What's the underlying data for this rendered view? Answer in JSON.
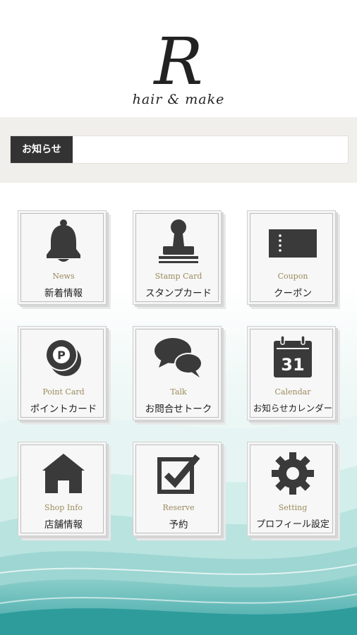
{
  "header": {
    "logo_letter": "R",
    "logo_subtitle": "hair & make"
  },
  "notice": {
    "tag_label": "お知らせ",
    "text": ""
  },
  "menu": [
    {
      "en": "News",
      "jp": "新着情報",
      "icon": "bell-icon"
    },
    {
      "en": "Stamp Card",
      "jp": "スタンプカード",
      "icon": "stamp-icon"
    },
    {
      "en": "Coupon",
      "jp": "クーポン",
      "icon": "ticket-icon"
    },
    {
      "en": "Point Card",
      "jp": "ポイントカード",
      "icon": "point-coins-icon"
    },
    {
      "en": "Talk",
      "jp": "お問合せトーク",
      "icon": "chat-bubbles-icon"
    },
    {
      "en": "Calendar",
      "jp": "お知らせカレンダー",
      "icon": "calendar-icon",
      "calendar_day": "31"
    },
    {
      "en": "Shop Info",
      "jp": "店舗情報",
      "icon": "house-icon"
    },
    {
      "en": "Reserve",
      "jp": "予約",
      "icon": "checkbox-icon"
    },
    {
      "en": "Setting",
      "jp": "プロフィール設定",
      "icon": "gear-icon"
    }
  ],
  "colors": {
    "accent_text": "#9a8a5b",
    "icon": "#3a3a3a",
    "notice_tag_bg": "#333333",
    "wave_teal": "#5bb8b4"
  }
}
